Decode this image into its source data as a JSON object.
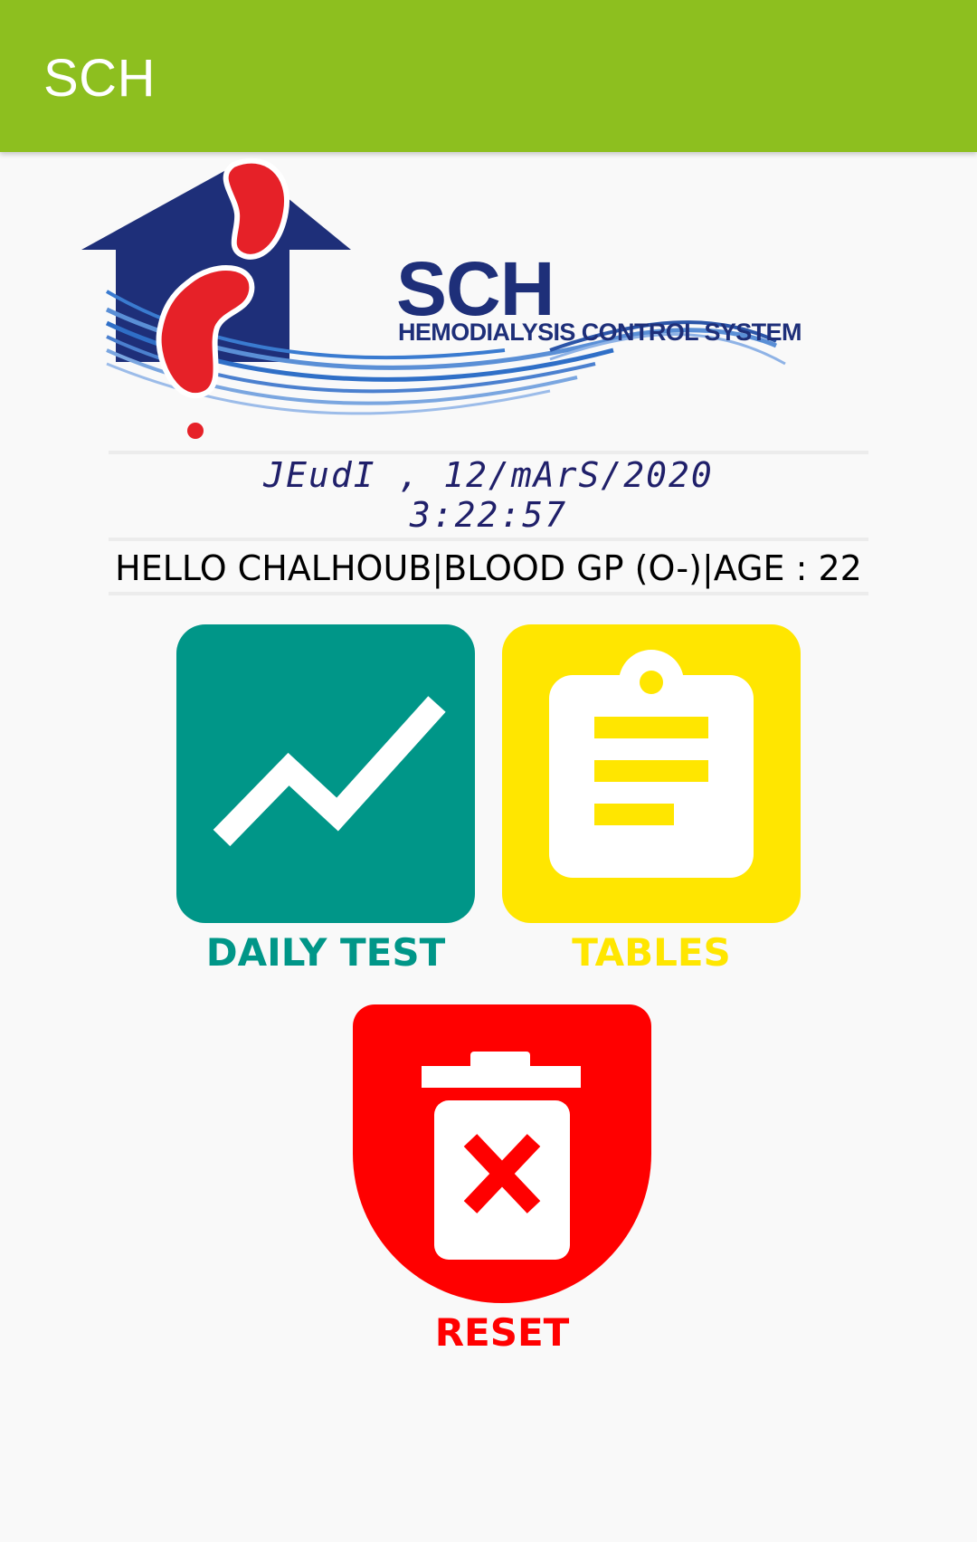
{
  "app_bar": {
    "title": "SCH"
  },
  "logo": {
    "brand": "SCH",
    "subtitle": "HEMODIALYSIS CONTROL SYSTEM"
  },
  "datetime": {
    "date": "JEudI ,  12/mArS/2020",
    "time": "3:22:57"
  },
  "greeting": "HELLO CHALHOUB|BLOOD GP (O-)|AGE : 22",
  "tiles": [
    {
      "label": "DAILY TEST",
      "icon": "trending-up-icon",
      "color": "#009688"
    },
    {
      "label": "TABLES",
      "icon": "clipboard-icon",
      "color": "#ffe600"
    },
    {
      "label": "RESET",
      "icon": "trash-delete-icon",
      "color": "#ff0000"
    }
  ],
  "colors": {
    "app_bar": "#8dbf1f",
    "logo_blue": "#1e2f79",
    "logo_red": "#e62128"
  }
}
